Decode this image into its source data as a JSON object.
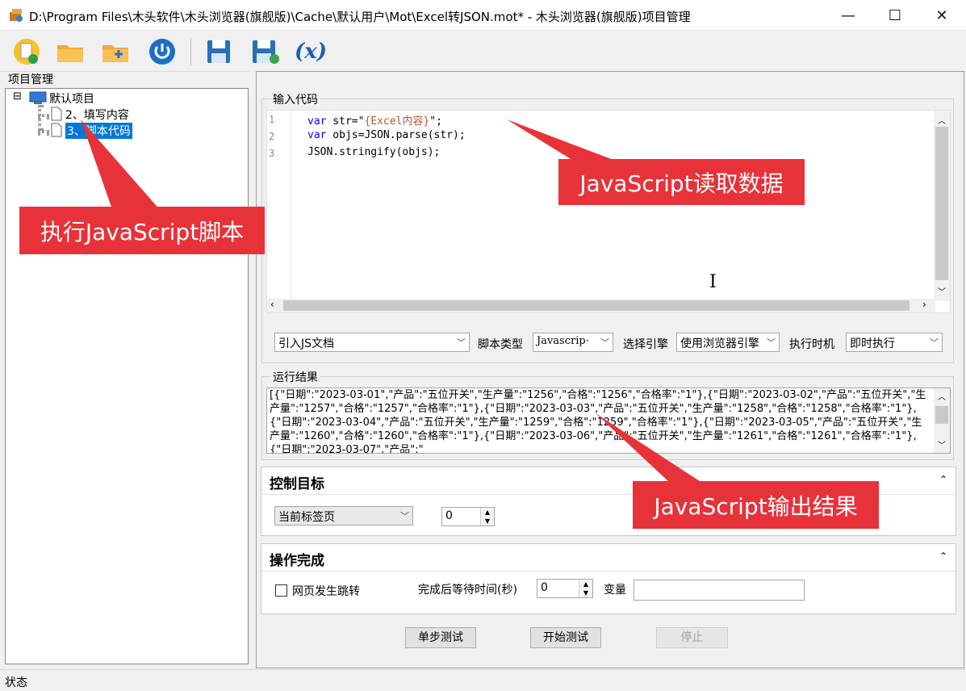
{
  "window": {
    "title": "D:\\Program Files\\木头软件\\木头浏览器(旗舰版)\\Cache\\默认用户\\Mot\\Excel转JSON.mot* - 木头浏览器(旗舰版)项目管理",
    "minimize": "—",
    "maximize": "☐",
    "close": "✕"
  },
  "toolbar": {
    "icons": [
      "new-file-icon",
      "open-folder-icon",
      "add-folder-icon",
      "power-icon",
      "save-icon",
      "save-as-icon",
      "variable-icon"
    ],
    "variable_label": "(x)"
  },
  "project_panel": {
    "label": "项目管理",
    "tree": {
      "root": "默认项目",
      "expander": "⊟",
      "children": [
        "2、填写内容",
        "3、脚本代码"
      ],
      "selected_index": 1
    }
  },
  "code_panel": {
    "label": "输入代码",
    "line_numbers": [
      "1",
      "2",
      "3"
    ],
    "lines": [
      {
        "kw": "var",
        "rest_pre": " str=\"",
        "str": "{Excel内容}",
        "rest_post": "\";"
      },
      {
        "kw": "var",
        "rest_pre": " objs=JSON.parse(str);",
        "str": "",
        "rest_post": ""
      },
      {
        "kw": "",
        "rest_pre": "JSON.stringify(objs);",
        "str": "",
        "rest_post": ""
      }
    ]
  },
  "options": {
    "import_js": "引入JS文档",
    "script_type_label": "脚本类型",
    "script_type": "Javascrip·",
    "engine_label": "选择引擎",
    "engine": "使用浏览器引擎",
    "exec_time_label": "执行时机",
    "exec_time": "即时执行"
  },
  "result_panel": {
    "label": "运行结果",
    "text": "[{\"日期\":\"2023-03-01\",\"产品\":\"五位开关\",\"生产量\":\"1256\",\"合格\":\"1256\",\"合格率\":\"1\"},{\"日期\":\"2023-03-02\",\"产品\":\"五位开关\",\"生产量\":\"1257\",\"合格\":\"1257\",\"合格率\":\"1\"},{\"日期\":\"2023-03-03\",\"产品\":\"五位开关\",\"生产量\":\"1258\",\"合格\":\"1258\",\"合格率\":\"1\"},{\"日期\":\"2023-03-04\",\"产品\":\"五位开关\",\"生产量\":\"1259\",\"合格\":\"1259\",\"合格率\":\"1\"},{\"日期\":\"2023-03-05\",\"产品\":\"五位开关\",\"生产量\":\"1260\",\"合格\":\"1260\",\"合格率\":\"1\"},{\"日期\":\"2023-03-06\",\"产品\":\"五位开关\",\"生产量\":\"1261\",\"合格\":\"1261\",\"合格率\":\"1\"},{\"日期\":\"2023-03-07\",\"产品\":\""
  },
  "control_target": {
    "header": "控制目标",
    "tab_select": "当前标签页",
    "index_value": "0",
    "caret": "⌃"
  },
  "operation_done": {
    "header": "操作完成",
    "page_jump_label": "网页发生跳转",
    "wait_label": "完成后等待时间(秒)",
    "wait_value": "0",
    "variable_label": "变量",
    "variable_value": "",
    "caret": "⌃"
  },
  "buttons": {
    "step_test": "单步测试",
    "start_test": "开始测试",
    "stop": "停止"
  },
  "status": {
    "text": "状态"
  },
  "annotations": {
    "read_data": "JavaScript读取数据",
    "execute_script": "执行JavaScript脚本",
    "output_result": "JavaScript输出结果"
  },
  "colors": {
    "callout": "#e8323a",
    "selection": "#0078d7",
    "keyword": "#0000ff",
    "string": "#b05a2a"
  }
}
